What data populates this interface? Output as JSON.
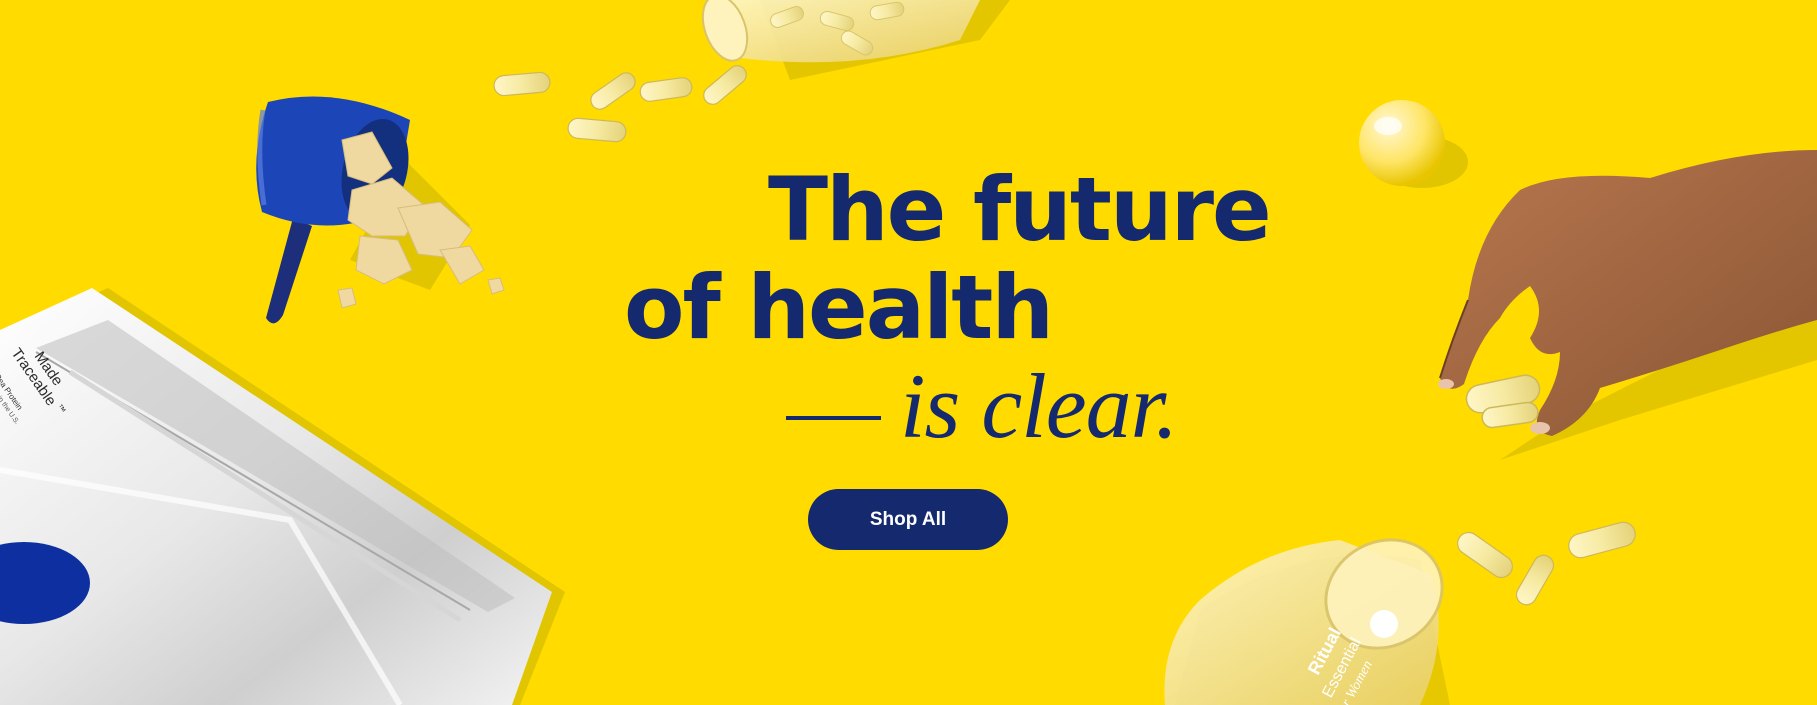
{
  "hero": {
    "headline_line1": "The future",
    "headline_line2": "of health",
    "headline_line3": "is clear.",
    "cta_label": "Shop All"
  },
  "bag_label": {
    "brand_line1": "Made",
    "brand_line2": "Traceable",
    "trademark": "™",
    "sub_line1": "Pea Protein",
    "sub_line2": "Made in the U.S."
  },
  "jar_label": {
    "line1": "Ritual",
    "line2": "Essential",
    "line3": "for Women"
  },
  "colors": {
    "background": "#FFDB00",
    "brand_navy": "#15296E",
    "scoop_blue": "#1C46B8"
  },
  "icons": [
    "pouch-icon",
    "scoop-icon",
    "capsule-icon",
    "softgel-icon",
    "jar-icon",
    "hand-icon"
  ]
}
